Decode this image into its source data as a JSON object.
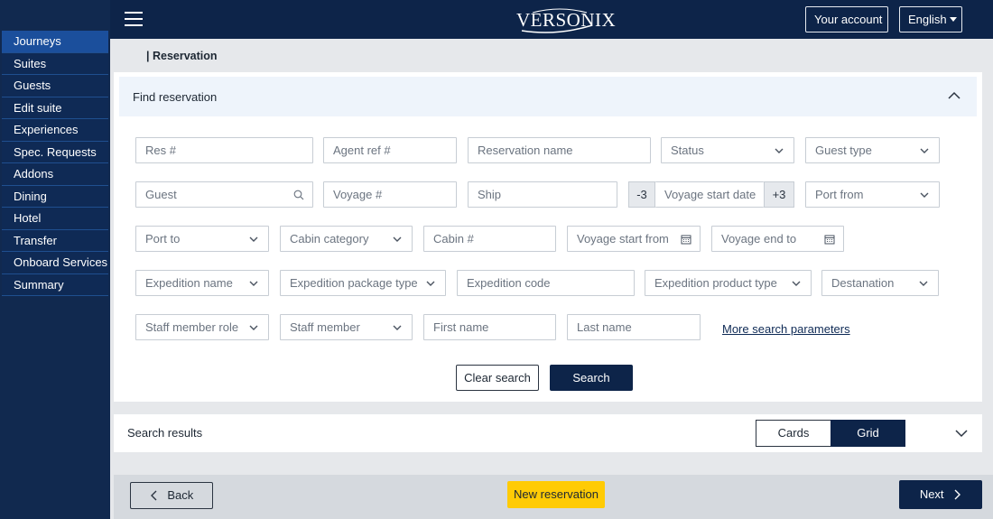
{
  "app": {
    "logo_text": "VERSONIX"
  },
  "header": {
    "account_label": "Your account",
    "language_label": "English"
  },
  "sidebar": {
    "items": [
      {
        "label": "Journeys",
        "active": true
      },
      {
        "label": "Suites"
      },
      {
        "label": "Guests"
      },
      {
        "label": "Edit suite"
      },
      {
        "label": "Experiences"
      },
      {
        "label": "Spec. Requests"
      },
      {
        "label": "Addons"
      },
      {
        "label": "Dining"
      },
      {
        "label": "Hotel"
      },
      {
        "label": "Transfer"
      },
      {
        "label": "Onboard Services"
      },
      {
        "label": "Summary"
      }
    ]
  },
  "breadcrumb": "| Reservation",
  "find_panel": {
    "title": "Find reservation",
    "fields": {
      "res_no": "Res #",
      "agent_ref": "Agent ref #",
      "reservation_name": "Reservation name",
      "status": "Status",
      "guest_type": "Guest type",
      "guest": "Guest",
      "voyage_no": "Voyage #",
      "ship": "Ship",
      "voyage_minus": "-3",
      "voyage_start_date": "Voyage start date",
      "voyage_plus": "+3",
      "port_from": "Port from",
      "port_to": "Port to",
      "cabin_category": "Cabin category",
      "cabin_no": "Cabin #",
      "voyage_start_from": "Voyage start from",
      "voyage_end_to": "Voyage end to",
      "expedition_name": "Expedition name",
      "expedition_package_type": "Expedition package type",
      "expedition_code": "Expedition code",
      "expedition_product_type": "Expedition product type",
      "destination": "Destanation",
      "staff_member_role": "Staff member role",
      "staff_member": "Staff member",
      "first_name": "First name",
      "last_name": "Last name"
    },
    "more_link": "More search parameters",
    "clear_label": "Clear search",
    "search_label": "Search"
  },
  "results": {
    "title": "Search results",
    "view_cards": "Cards",
    "view_grid": "Grid",
    "selected_view": "Grid"
  },
  "footer": {
    "back_label": "Back",
    "new_reservation_label": "New reservation",
    "next_label": "Next"
  },
  "colors": {
    "navy": "#0d2449",
    "sidebar_active": "#1b4f9c",
    "accent_yellow": "#ffcb05"
  }
}
